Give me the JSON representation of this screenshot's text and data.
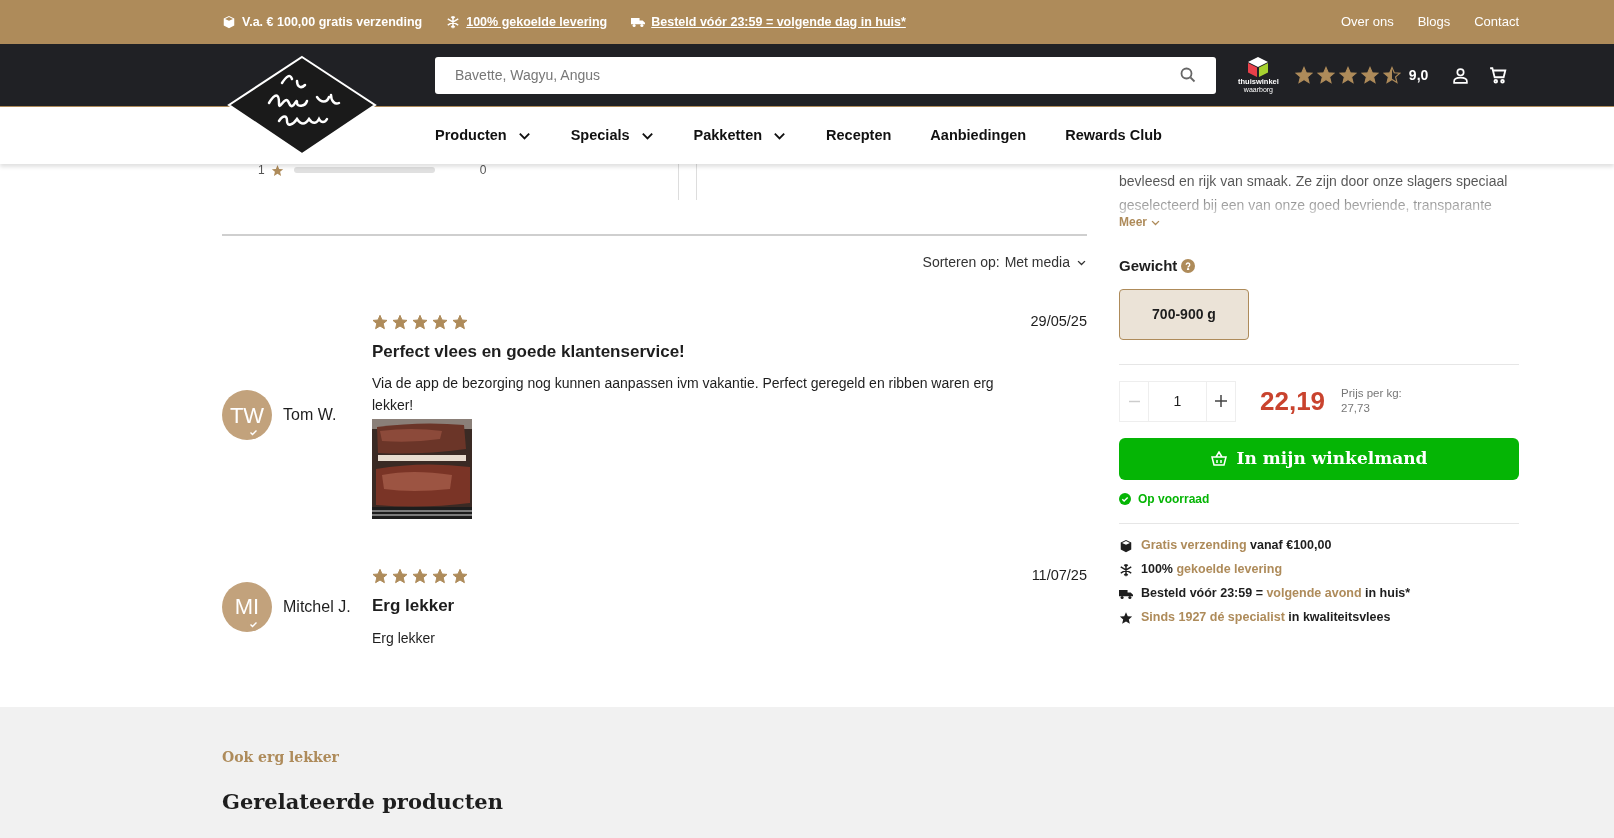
{
  "top_bar": {
    "usps": [
      {
        "kind": "package",
        "text": "V.a. € 100,00 gratis verzending",
        "link": false
      },
      {
        "kind": "snow",
        "text": "100% gekoelde levering",
        "link": true
      },
      {
        "kind": "truck",
        "text": "Besteld vóór 23:59 = volgende dag in huis*",
        "link": true
      }
    ],
    "links": [
      "Over ons",
      "Blogs",
      "Contact"
    ]
  },
  "header": {
    "search": {
      "placeholder": "Bavette, Wagyu, Angus"
    },
    "badge": {
      "line1": "thuiswinkel",
      "line2": "waarborg"
    },
    "rating": {
      "stars": 4.5,
      "score": "9,0"
    }
  },
  "nav": [
    {
      "label": "Producten",
      "dropdown": true
    },
    {
      "label": "Specials",
      "dropdown": true
    },
    {
      "label": "Pakketten",
      "dropdown": true
    },
    {
      "label": "Recepten",
      "dropdown": false
    },
    {
      "label": "Aanbiedingen",
      "dropdown": false
    },
    {
      "label": "Rewards Club",
      "dropdown": false
    }
  ],
  "distribution": [
    {
      "label": "1",
      "count": "0",
      "level": 0
    }
  ],
  "sort": {
    "label": "Sorteren op:",
    "value": "Met media"
  },
  "reviews": [
    {
      "initials": "TW",
      "name": "Tom W.",
      "stars": 5,
      "date": "29/05/25",
      "title": "Perfect vlees en goede klantenservice!",
      "text": "Via de app de bezorging nog kunnen aanpassen ivm vakantie. Perfect geregeld en ribben waren erg lekker!",
      "photo": true
    },
    {
      "initials": "MI",
      "name": "Mitchel J.",
      "stars": 5,
      "date": "11/07/25",
      "title": "Erg lekker",
      "text": "Erg lekker",
      "photo": false
    }
  ],
  "product": {
    "description": "bevleesd en rijk van smaak. Ze zijn door onze slagers speciaal geselecteerd bij een van onze goed bevriende, transparante",
    "more": "Meer",
    "weight_label": "Gewicht",
    "weights": [
      {
        "label": "700-900 g",
        "selected": true
      }
    ],
    "quantity": "1",
    "price": "22,19",
    "unit_price_label": "Prijs per kg:",
    "unit_price": "27,73",
    "cart_button": "In mijn winkelmand",
    "stock": "Op voorraad",
    "usps": [
      {
        "kind": "package",
        "parts": [
          {
            "text": "Gratis verzending",
            "highlight": true
          },
          {
            "text": " vanaf €100,00",
            "highlight": false
          }
        ]
      },
      {
        "kind": "snow",
        "parts": [
          {
            "text": "100% ",
            "highlight": false
          },
          {
            "text": "gekoelde levering",
            "highlight": true
          }
        ]
      },
      {
        "kind": "truck",
        "parts": [
          {
            "text": "Besteld vóór 23:59 = ",
            "highlight": false
          },
          {
            "text": "volgende avond",
            "highlight": true
          },
          {
            "text": " in huis*",
            "highlight": false
          }
        ]
      },
      {
        "kind": "star",
        "parts": [
          {
            "text": "Sinds 1927 dé specialist",
            "highlight": true
          },
          {
            "text": " in kwaliteitsvlees",
            "highlight": false
          }
        ]
      }
    ]
  },
  "related": {
    "eyebrow": "Ook erg lekker",
    "title": "Gerelateerde producten"
  }
}
